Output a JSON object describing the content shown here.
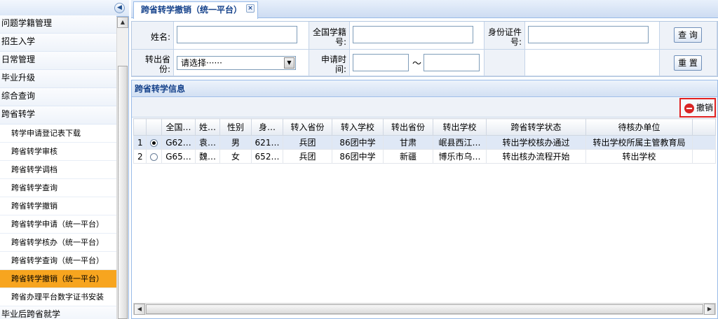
{
  "sidebar": {
    "collapse_icon": "double-chevron-left",
    "items": [
      {
        "label": "问题学籍管理",
        "type": "group"
      },
      {
        "label": "招生入学",
        "type": "group"
      },
      {
        "label": "日常管理",
        "type": "group"
      },
      {
        "label": "毕业升级",
        "type": "group"
      },
      {
        "label": "综合查询",
        "type": "group"
      },
      {
        "label": "跨省转学",
        "type": "group"
      },
      {
        "label": "转学申请登记表下载",
        "type": "sub"
      },
      {
        "label": "跨省转学审核",
        "type": "sub"
      },
      {
        "label": "跨省转学调档",
        "type": "sub"
      },
      {
        "label": "跨省转学查询",
        "type": "sub"
      },
      {
        "label": "跨省转学撤销",
        "type": "sub"
      },
      {
        "label": "跨省转学申请（统一平台）",
        "type": "sub"
      },
      {
        "label": "跨省转学核办（统一平台）",
        "type": "sub"
      },
      {
        "label": "跨省转学查询（统一平台）",
        "type": "sub"
      },
      {
        "label": "跨省转学撤销（统一平台）",
        "type": "sub",
        "active": true
      },
      {
        "label": "跨省办理平台数字证书安装",
        "type": "sub"
      },
      {
        "label": "毕业后跨省就学",
        "type": "group"
      }
    ]
  },
  "tab": {
    "title": "跨省转学撤销（统一平台）",
    "close_icon": "×"
  },
  "search": {
    "name_label": "姓名:",
    "name_value": "",
    "national_id_label_1": "全国学籍",
    "national_id_label_2": "号:",
    "national_id_value": "",
    "id_card_label_1": "身份证件",
    "id_card_label_2": "号:",
    "id_card_value": "",
    "from_province_label_1": "转出省",
    "from_province_label_2": "份:",
    "from_province_selected": "请选择······",
    "apply_time_label_1": "申请时",
    "apply_time_label_2": "间:",
    "date_from": "",
    "date_to": "",
    "range_separator": "～",
    "query_button": "查 询",
    "reset_button": "重 置"
  },
  "grid": {
    "title": "跨省转学信息",
    "cancel_button": "撤销",
    "columns": [
      "",
      "",
      "全国…",
      "姓…",
      "性别",
      "身…",
      "转入省份",
      "转入学校",
      "转出省份",
      "转出学校",
      "跨省转学状态",
      "待核办单位"
    ],
    "rows": [
      {
        "num": "1",
        "selected": true,
        "cells": [
          "G62…",
          "袁…",
          "男",
          "621…",
          "兵团",
          "86团中学",
          "甘肃",
          "岷县西江…",
          "转出学校核办通过",
          "转出学校所属主管教育局"
        ]
      },
      {
        "num": "2",
        "selected": false,
        "cells": [
          "G65…",
          "魏…",
          "女",
          "652…",
          "兵团",
          "86团中学",
          "新疆",
          "博乐市乌…",
          "转出核办流程开始",
          "转出学校"
        ]
      }
    ]
  }
}
